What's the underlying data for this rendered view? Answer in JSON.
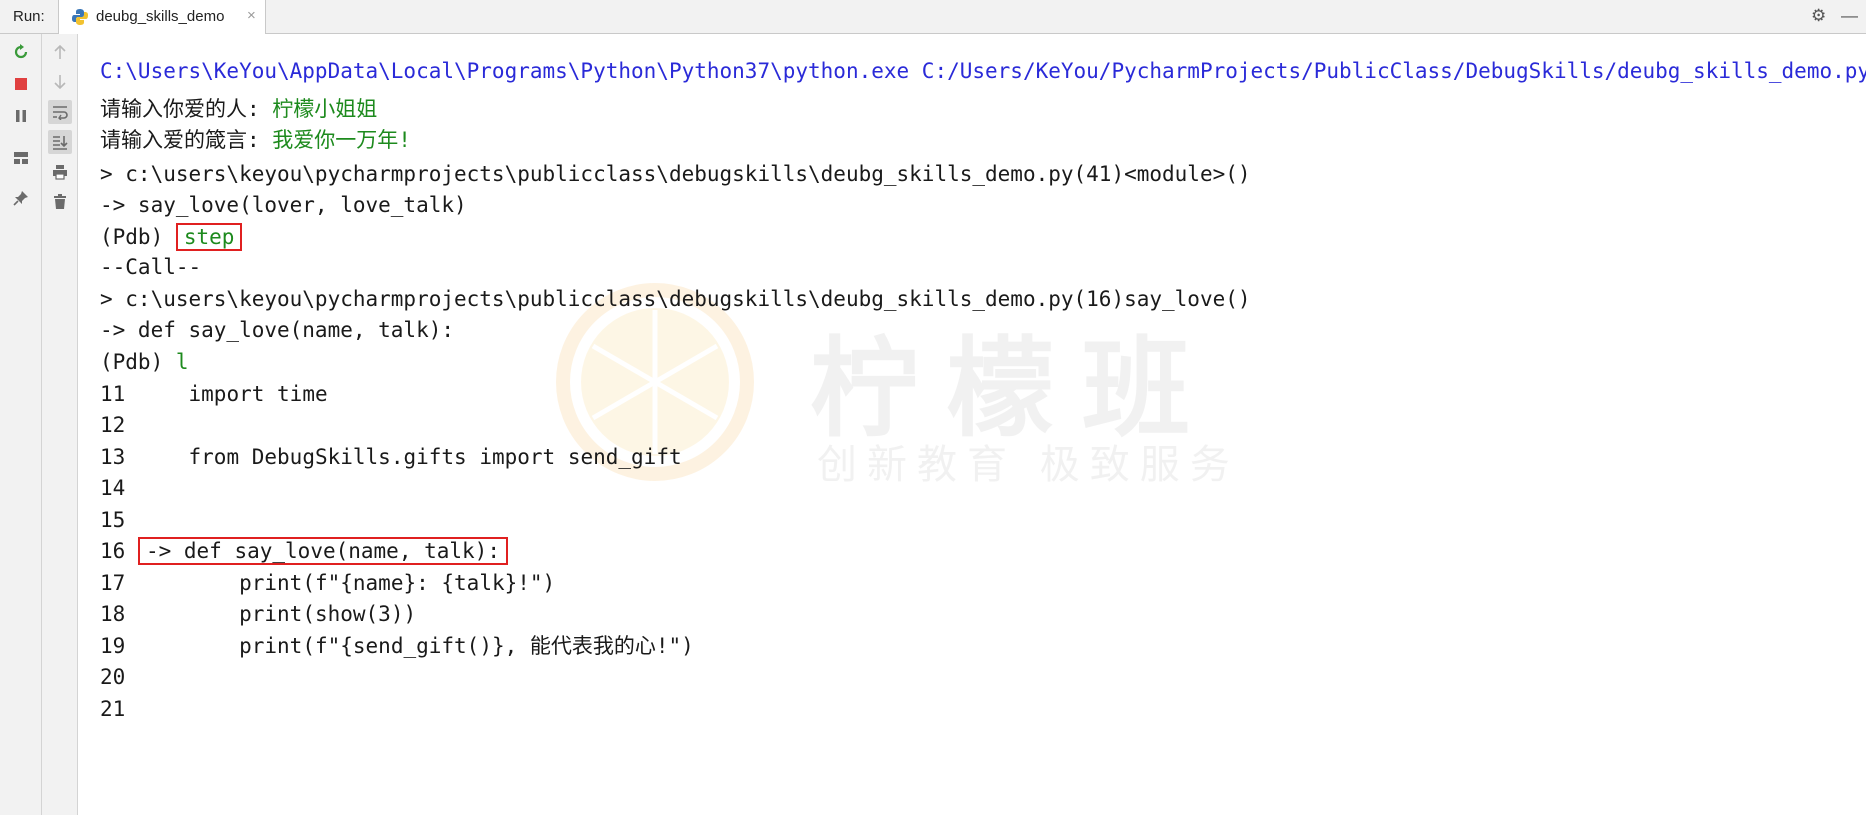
{
  "topbar": {
    "run_label": "Run:",
    "tab_label": "deubg_skills_demo",
    "tab_close": "×",
    "settings_icon": "⚙",
    "minimize_icon": "—"
  },
  "toolbar_icons": {
    "rerun": "rerun-icon",
    "stop": "stop-icon",
    "pause": "pause-icon",
    "layout": "layout-icon",
    "pin": "pin-icon",
    "up": "arrow-up-icon",
    "down": "arrow-down-icon",
    "wrap": "soft-wrap-icon",
    "scroll": "scroll-to-end-icon",
    "print": "print-icon",
    "trash": "trash-icon"
  },
  "console": {
    "cmd": "C:\\Users\\KeYou\\AppData\\Local\\Programs\\Python\\Python37\\python.exe C:/Users/KeYou/PycharmProjects/PublicClass/DebugSkills/deubg_skills_demo.py",
    "prompt1_label": "请输入你爱的人: ",
    "prompt1_value": "柠檬小姐姐",
    "prompt2_label": "请输入爱的箴言: ",
    "prompt2_value": "我爱你一万年!",
    "loc1": "> c:\\users\\keyou\\pycharmprojects\\publicclass\\debugskills\\deubg_skills_demo.py(41)<module>()",
    "arrow1": "-> say_love(lover, love_talk)",
    "pdb_prompt": "(Pdb)",
    "cmd_step": "step",
    "call_marker": "--Call--",
    "loc2": "> c:\\users\\keyou\\pycharmprojects\\publicclass\\debugskills\\deubg_skills_demo.py(16)say_love()",
    "arrow2": "-> def say_love(name, talk):",
    "cmd_list": "l",
    "listing": [
      {
        "num": "11",
        "code": "    import time"
      },
      {
        "num": "12",
        "code": ""
      },
      {
        "num": "13",
        "code": "    from DebugSkills.gifts import send_gift"
      },
      {
        "num": "14",
        "code": ""
      },
      {
        "num": "15",
        "code": ""
      },
      {
        "num": "16",
        "code": "-> def say_love(name, talk):"
      },
      {
        "num": "17",
        "code": "        print(f\"{name}: {talk}!\")"
      },
      {
        "num": "18",
        "code": "        print(show(3))"
      },
      {
        "num": "19",
        "code": "        print(f\"{send_gift()}, 能代表我的心!\")"
      },
      {
        "num": "20",
        "code": ""
      },
      {
        "num": "21",
        "code": ""
      }
    ]
  },
  "watermark": {
    "line1": "柠檬班",
    "line2": "创新教育  极致服务"
  }
}
